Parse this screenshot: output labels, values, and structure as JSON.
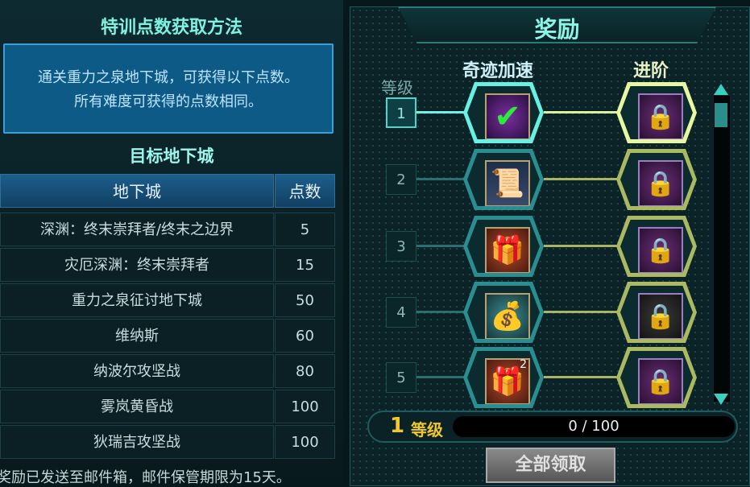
{
  "left_panel": {
    "title": "特训点数获取方法",
    "info_lines": [
      "通关重力之泉地下城，可获得以下点数。",
      "所有难度可获得的点数相同。"
    ],
    "section_title": "目标地下城",
    "table": {
      "headers": [
        "地下城",
        "点数"
      ],
      "rows": [
        {
          "dungeon": "深渊：终末崇拜者/终末之边界",
          "points": "5"
        },
        {
          "dungeon": "灾厄深渊：终末崇拜者",
          "points": "15"
        },
        {
          "dungeon": "重力之泉征讨地下城",
          "points": "50"
        },
        {
          "dungeon": "维纳斯",
          "points": "60"
        },
        {
          "dungeon": "纳波尔攻坚战",
          "points": "80"
        },
        {
          "dungeon": "雾岚黄昏战",
          "points": "100"
        },
        {
          "dungeon": "狄瑞吉攻坚战",
          "points": "100"
        }
      ]
    },
    "footer_note": "奖励已发送至邮件箱，邮件保管期限为15天。"
  },
  "rewards": {
    "title": "奖励",
    "level_label": "等级",
    "accel_label": "奇迹加速",
    "advanced_label": "进阶",
    "rows": [
      {
        "level": "1",
        "accel_icon": "check-icon",
        "claimed": true,
        "advanced_icon": "lock-icon"
      },
      {
        "level": "2",
        "accel_icon": "map-scroll-icon",
        "claimed": false,
        "advanced_icon": "lock-icon"
      },
      {
        "level": "3",
        "accel_icon": "red-box-icon",
        "claimed": false,
        "advanced_icon": "lock-icon"
      },
      {
        "level": "4",
        "accel_icon": "pouch-icon",
        "claimed": false,
        "advanced_icon": "lock-icon"
      },
      {
        "level": "5",
        "accel_icon": "red-box-icon",
        "accel_count": "2",
        "claimed": false,
        "advanced_icon": "lock-icon"
      }
    ]
  },
  "level_bar": {
    "level": "1",
    "level_word": "等级",
    "progress_text": "0 / 100",
    "progress": 0
  },
  "claim_all_label": "全部领取"
}
